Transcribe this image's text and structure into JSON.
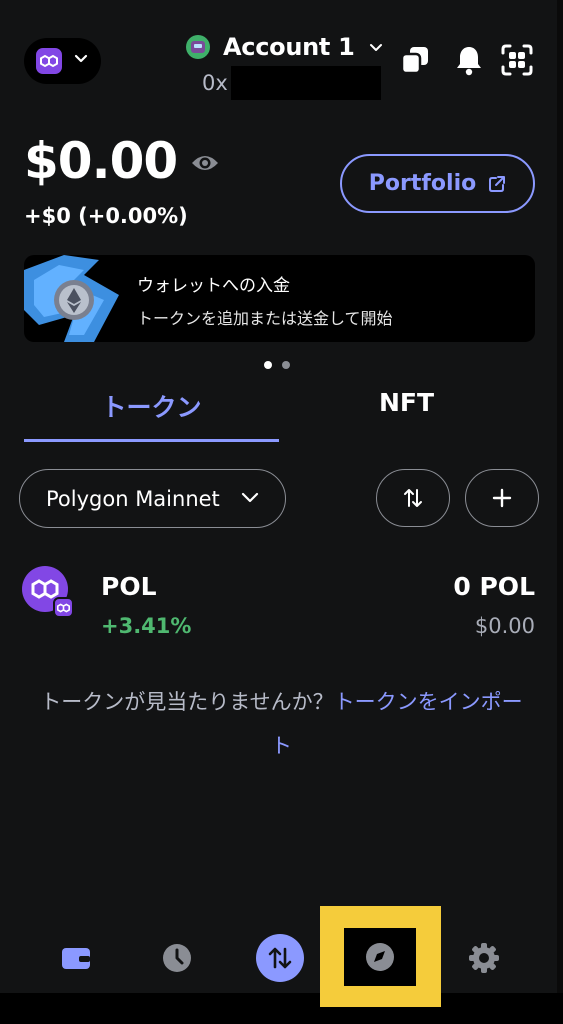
{
  "header": {
    "network_icon": "polygon-icon",
    "account_name": "Account 1",
    "address_prefix": "0x",
    "icons": [
      "copy-icon",
      "bell-icon",
      "apps-icon"
    ]
  },
  "balance": {
    "total": "$0.00",
    "change": "+$0 (+0.00%)",
    "portfolio_label": "Portfolio"
  },
  "banner": {
    "title": "ウォレットへの入金",
    "subtitle": "トークンを追加または送金して開始",
    "page_dots": {
      "count": 2,
      "active": 1
    }
  },
  "tabs": [
    {
      "label": "トークン",
      "active": true
    },
    {
      "label": "NFT",
      "active": false
    }
  ],
  "filter": {
    "network_label": "Polygon Mainnet"
  },
  "tokens": [
    {
      "name": "POL",
      "change": "+3.41%",
      "amount": "0 POL",
      "fiat": "$0.00"
    }
  ],
  "import": {
    "question": "トークンが見当たりませんか？",
    "link_part1": "トークンをインポー",
    "link_part2": "ト"
  },
  "bottom_nav": [
    {
      "name": "wallet-icon",
      "active": false
    },
    {
      "name": "clock-icon",
      "active": false
    },
    {
      "name": "swap-icon",
      "active": false
    },
    {
      "name": "compass-icon",
      "active": true
    },
    {
      "name": "gear-icon",
      "active": false
    }
  ],
  "colors": {
    "background": "#121314",
    "accent": "#8b99ff",
    "positive": "#4fb870",
    "polygon": "#8247e5",
    "highlight": "#f5cc3b"
  }
}
